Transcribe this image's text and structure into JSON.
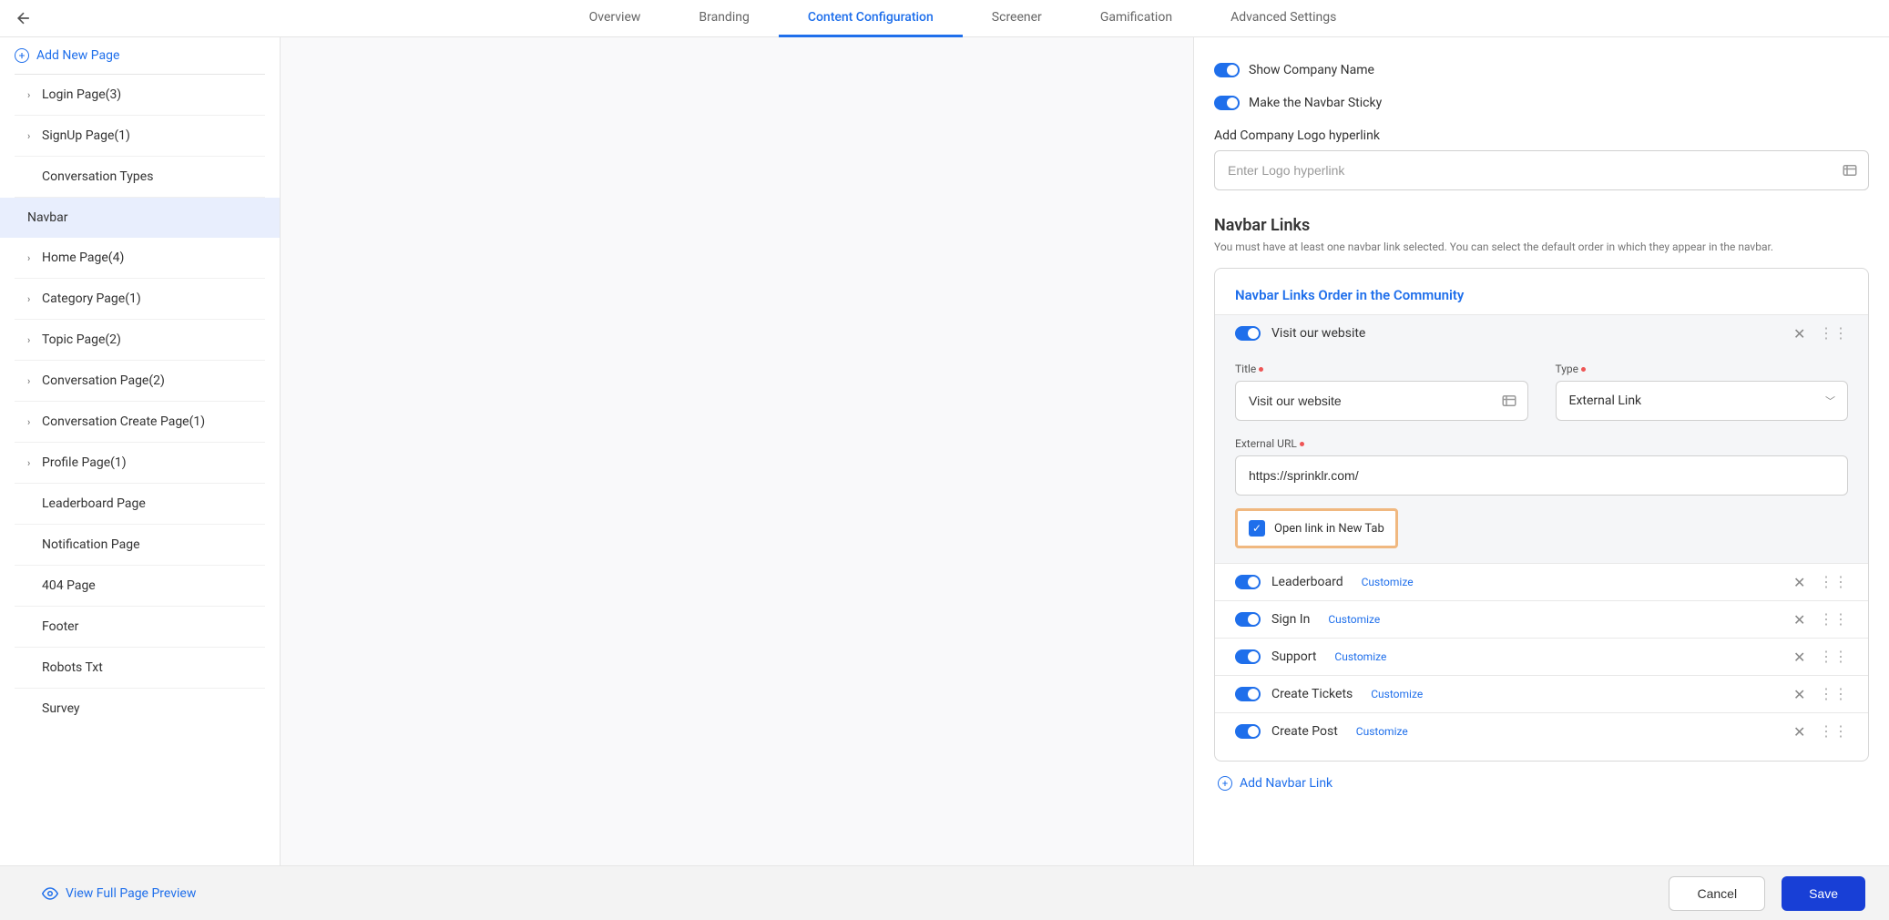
{
  "tabs": {
    "items": [
      "Overview",
      "Branding",
      "Content Configuration",
      "Screener",
      "Gamification",
      "Advanced Settings"
    ],
    "active_index": 2
  },
  "sidebar": {
    "add_page_label": "Add New Page",
    "items": [
      {
        "label": "Login Page(3)",
        "has_chevron": true,
        "active": false
      },
      {
        "label": "SignUp Page(1)",
        "has_chevron": true,
        "active": false
      },
      {
        "label": "Conversation Types",
        "has_chevron": false,
        "active": false
      },
      {
        "label": "Navbar",
        "has_chevron": false,
        "active": true
      },
      {
        "label": "Home Page(4)",
        "has_chevron": true,
        "active": false
      },
      {
        "label": "Category Page(1)",
        "has_chevron": true,
        "active": false
      },
      {
        "label": "Topic Page(2)",
        "has_chevron": true,
        "active": false
      },
      {
        "label": "Conversation Page(2)",
        "has_chevron": true,
        "active": false
      },
      {
        "label": "Conversation Create Page(1)",
        "has_chevron": true,
        "active": false
      },
      {
        "label": "Profile Page(1)",
        "has_chevron": true,
        "active": false
      },
      {
        "label": "Leaderboard Page",
        "has_chevron": false,
        "active": false
      },
      {
        "label": "Notification Page",
        "has_chevron": false,
        "active": false
      },
      {
        "label": "404 Page",
        "has_chevron": false,
        "active": false
      },
      {
        "label": "Footer",
        "has_chevron": false,
        "active": false
      },
      {
        "label": "Robots Txt",
        "has_chevron": false,
        "active": false
      },
      {
        "label": "Survey",
        "has_chevron": false,
        "active": false
      }
    ]
  },
  "right_panel": {
    "toggle_company_name": "Show Company Name",
    "toggle_sticky": "Make the Navbar Sticky",
    "logo_hyperlink_label": "Add Company Logo hyperlink",
    "logo_hyperlink_placeholder": "Enter Logo hyperlink",
    "section_title": "Navbar Links",
    "section_desc": "You must have at least one navbar link selected. You can select the default order in which they appear in the navbar.",
    "card_title": "Navbar Links Order in the Community",
    "expanded_item": {
      "name": "Visit our website",
      "title_label": "Title",
      "title_value": "Visit our website",
      "type_label": "Type",
      "type_value": "External Link",
      "url_label": "External URL",
      "url_value": "https://sprinklr.com/",
      "checkbox_label": "Open link in New Tab"
    },
    "link_items": [
      {
        "name": "Leaderboard",
        "customize": "Customize"
      },
      {
        "name": "Sign In",
        "customize": "Customize"
      },
      {
        "name": "Support",
        "customize": "Customize"
      },
      {
        "name": "Create Tickets",
        "customize": "Customize"
      },
      {
        "name": "Create Post",
        "customize": "Customize"
      }
    ],
    "add_link_label": "Add Navbar Link"
  },
  "footer": {
    "preview_label": "View Full Page Preview",
    "cancel_label": "Cancel",
    "save_label": "Save"
  }
}
